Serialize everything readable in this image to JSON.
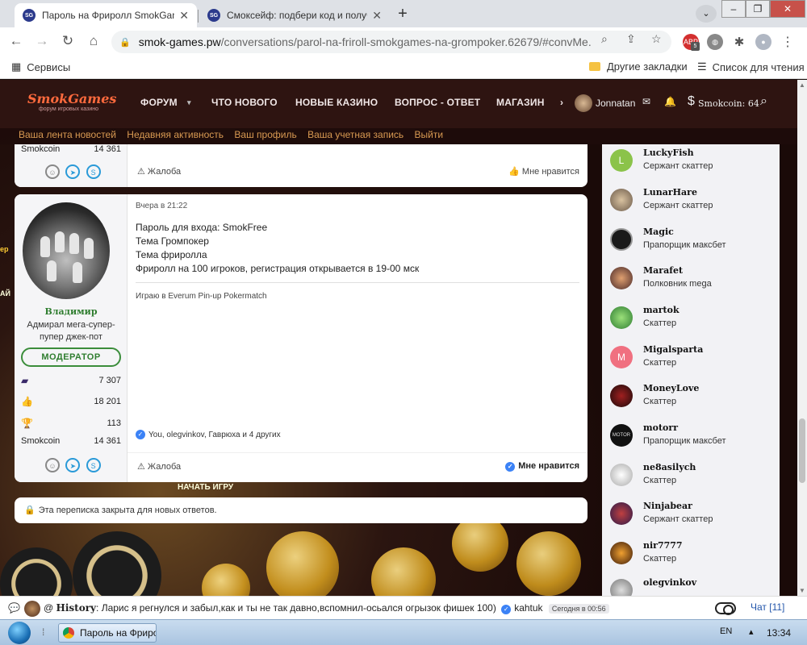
{
  "browser": {
    "tabs": [
      {
        "title": "Пароль на Фриролл SmokGames",
        "active": true,
        "favicon": "SG"
      },
      {
        "title": "Смоксейф: подбери код и получ",
        "active": false,
        "favicon": "SG"
      }
    ],
    "address": {
      "host": "smok-games.pw",
      "path": "/conversations/parol-na-friroll-smokgames-na-grompoker.62679/#convMe..."
    },
    "bookmarks": {
      "services": "Сервисы",
      "other": "Другие закладки",
      "reading_list": "Список для чтения"
    },
    "ext_badge": "5"
  },
  "site": {
    "logo": "SmokGames",
    "logo_sub": "форум игровых казино",
    "nav": [
      "ФОРУМ",
      "ЧТО НОВОГО",
      "НОВЫЕ КАЗИНО",
      "ВОПРОС - ОТВЕТ",
      "МАГАЗИН"
    ],
    "nav_more": "›",
    "user": "Jonnatan",
    "coins": "Smokcoin: 64",
    "subnav": [
      "Ваша лента новостей",
      "Недавняя активность",
      "Ваш профиль",
      "Ваша учетная запись",
      "Выйти"
    ]
  },
  "prev_post": {
    "coins_label": "Smokcoin",
    "coins_value": "14 361",
    "report": "Жалоба",
    "like": "Мне нравится"
  },
  "post": {
    "time": "Вчера в 21:22",
    "author": "Владимир",
    "rank": "Адмирал мега-супер-пупер джек-пот",
    "badge": "МОДЕРАТОР",
    "stats": [
      {
        "icon": "messages-icon",
        "value": "7 307"
      },
      {
        "icon": "thumbs-up-icon",
        "value": "18 201"
      },
      {
        "icon": "trophy-icon",
        "value": "113"
      }
    ],
    "coins_label": "Smokcoin",
    "coins_value": "14 361",
    "lines": [
      "Пароль для входа: SmokFree",
      "Тема Громпокер",
      "Тема фриролла",
      "Фриролл на 100 игроков, регистрация открывается в 19-00 мск"
    ],
    "signature": "Играю в Everum Pin-up Pokermatch",
    "likers": "You, olegvinkov, Гаврюха и 4 других",
    "report": "Жалоба",
    "like": "Мне нравится"
  },
  "closed_notice": "Эта переписка закрыта для новых ответов.",
  "start_game": "НАЧАТЬ ИГРУ",
  "members": [
    {
      "name": "LuckyFish",
      "rank": "Сержант скаттер",
      "avatar_color": "#8bc34a",
      "letter": "L"
    },
    {
      "name": "LunarHare",
      "rank": "Сержант скаттер",
      "avatar_color": "#6b5a4a",
      "letter": ""
    },
    {
      "name": "Magic",
      "rank": "Прапорщик максбет",
      "avatar_color": "#1a1a1a",
      "letter": ""
    },
    {
      "name": "Marafet",
      "rank": "Полковник mega",
      "avatar_color": "#7a4a2a",
      "letter": ""
    },
    {
      "name": "martok",
      "rank": "Скаттер",
      "avatar_color": "#4caf50",
      "letter": ""
    },
    {
      "name": "Migalsparta",
      "rank": "Скаттер",
      "avatar_color": "#f07080",
      "letter": "M"
    },
    {
      "name": "MoneyLove",
      "rank": "Скаттер",
      "avatar_color": "#2a1a1a",
      "letter": ""
    },
    {
      "name": "motorr",
      "rank": "Прапорщик максбет",
      "avatar_color": "#111111",
      "letter": "MOTOR"
    },
    {
      "name": "ne8asilych",
      "rank": "Скаттер",
      "avatar_color": "#d8d8d8",
      "letter": ""
    },
    {
      "name": "Ninjabear",
      "rank": "Сержант скаттер",
      "avatar_color": "#3a2a6a",
      "letter": ""
    },
    {
      "name": "nir7777",
      "rank": "Скаттер",
      "avatar_color": "#5a3a1a",
      "letter": ""
    },
    {
      "name": "olegvinkov",
      "rank": "",
      "avatar_color": "#9a9a9a",
      "letter": ""
    }
  ],
  "chat": {
    "at": "@",
    "user": "History",
    "message": ": Ларис я регнулся и забыл,как и ты не так давно,вспомнил-осьался огрызок фишек 100)",
    "reply_user": "kahtuk",
    "time": "Сегодня в 00:56",
    "label": "Чат [11]"
  },
  "taskbar": {
    "item": "Пароль на Фрирол",
    "lang": "EN",
    "clock": "13:34"
  }
}
